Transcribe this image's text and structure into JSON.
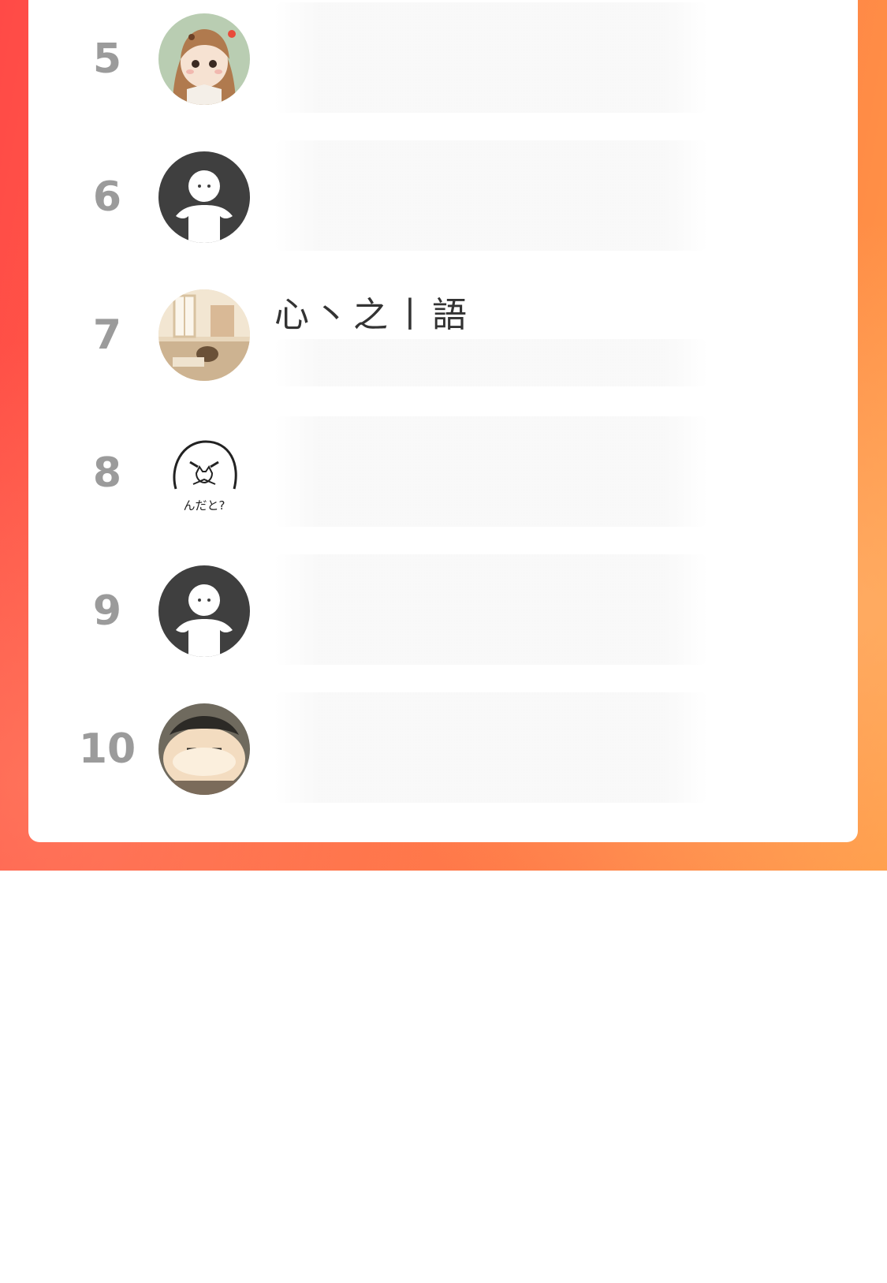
{
  "colors": {
    "background_gradient_start": "#ff4a47",
    "background_gradient_end": "#ff9a45",
    "card": "#ffffff",
    "rank_text": "#9b9b9b",
    "name_text": "#333333"
  },
  "ranking": {
    "items": [
      {
        "rank": "5",
        "name": "",
        "avatar_icon": "cartoon-girl-avatar-icon"
      },
      {
        "rank": "6",
        "name": "",
        "avatar_icon": "default-user-avatar-icon"
      },
      {
        "rank": "7",
        "name": "心丶之丨語",
        "avatar_icon": "room-photo-avatar-icon"
      },
      {
        "rank": "8",
        "name": "",
        "avatar_icon": "sketch-cat-avatar-icon"
      },
      {
        "rank": "9",
        "name": "",
        "avatar_icon": "default-user-avatar-icon"
      },
      {
        "rank": "10",
        "name": "",
        "avatar_icon": "cartoon-boy-avatar-icon"
      }
    ],
    "sticker_text": "んだと?"
  }
}
